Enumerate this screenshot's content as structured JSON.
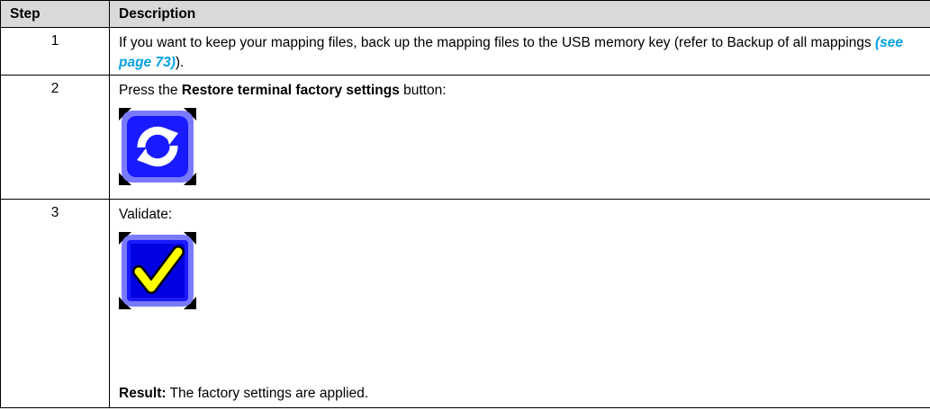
{
  "table": {
    "headers": {
      "step": "Step",
      "description": "Description"
    },
    "rows": [
      {
        "step": "1",
        "text_before": "If you want to keep your mapping files, back up the mapping files to the USB memory key (refer to Backup of all mappings ",
        "link": "(see page 73)",
        "text_after": ")."
      },
      {
        "step": "2",
        "text_before": "Press the ",
        "bold": "Restore terminal factory settings",
        "text_after": " button:",
        "icon": "restore-icon"
      },
      {
        "step": "3",
        "text": "Validate:",
        "icon": "checkmark-icon",
        "result_label": "Result:",
        "result_text": " The factory settings are applied."
      }
    ]
  },
  "colors": {
    "header_bg": "#d9d9d9",
    "link": "#00a0e3",
    "icon_blue": "#1a1aff",
    "check_yellow": "#ffff00"
  }
}
